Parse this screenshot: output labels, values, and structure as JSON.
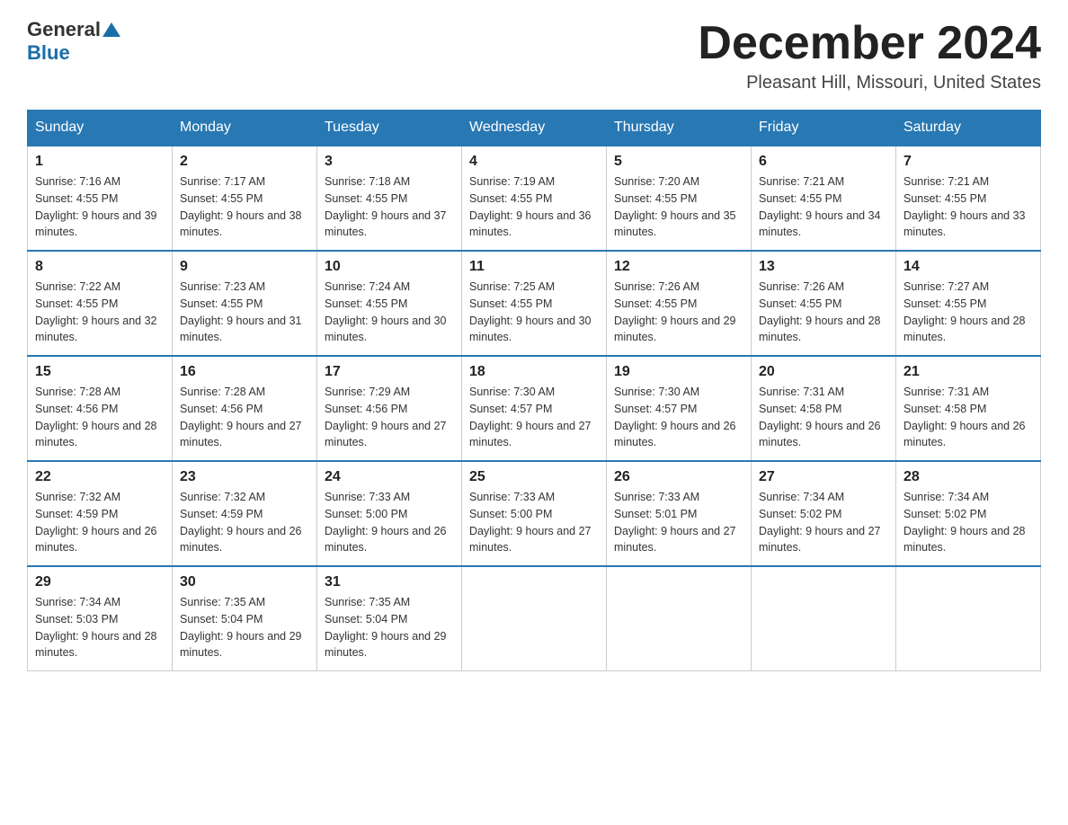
{
  "logo": {
    "general": "General",
    "blue": "Blue"
  },
  "title": "December 2024",
  "location": "Pleasant Hill, Missouri, United States",
  "weekdays": [
    "Sunday",
    "Monday",
    "Tuesday",
    "Wednesday",
    "Thursday",
    "Friday",
    "Saturday"
  ],
  "weeks": [
    [
      {
        "num": "1",
        "sunrise": "7:16 AM",
        "sunset": "4:55 PM",
        "daylight": "9 hours and 39 minutes."
      },
      {
        "num": "2",
        "sunrise": "7:17 AM",
        "sunset": "4:55 PM",
        "daylight": "9 hours and 38 minutes."
      },
      {
        "num": "3",
        "sunrise": "7:18 AM",
        "sunset": "4:55 PM",
        "daylight": "9 hours and 37 minutes."
      },
      {
        "num": "4",
        "sunrise": "7:19 AM",
        "sunset": "4:55 PM",
        "daylight": "9 hours and 36 minutes."
      },
      {
        "num": "5",
        "sunrise": "7:20 AM",
        "sunset": "4:55 PM",
        "daylight": "9 hours and 35 minutes."
      },
      {
        "num": "6",
        "sunrise": "7:21 AM",
        "sunset": "4:55 PM",
        "daylight": "9 hours and 34 minutes."
      },
      {
        "num": "7",
        "sunrise": "7:21 AM",
        "sunset": "4:55 PM",
        "daylight": "9 hours and 33 minutes."
      }
    ],
    [
      {
        "num": "8",
        "sunrise": "7:22 AM",
        "sunset": "4:55 PM",
        "daylight": "9 hours and 32 minutes."
      },
      {
        "num": "9",
        "sunrise": "7:23 AM",
        "sunset": "4:55 PM",
        "daylight": "9 hours and 31 minutes."
      },
      {
        "num": "10",
        "sunrise": "7:24 AM",
        "sunset": "4:55 PM",
        "daylight": "9 hours and 30 minutes."
      },
      {
        "num": "11",
        "sunrise": "7:25 AM",
        "sunset": "4:55 PM",
        "daylight": "9 hours and 30 minutes."
      },
      {
        "num": "12",
        "sunrise": "7:26 AM",
        "sunset": "4:55 PM",
        "daylight": "9 hours and 29 minutes."
      },
      {
        "num": "13",
        "sunrise": "7:26 AM",
        "sunset": "4:55 PM",
        "daylight": "9 hours and 28 minutes."
      },
      {
        "num": "14",
        "sunrise": "7:27 AM",
        "sunset": "4:55 PM",
        "daylight": "9 hours and 28 minutes."
      }
    ],
    [
      {
        "num": "15",
        "sunrise": "7:28 AM",
        "sunset": "4:56 PM",
        "daylight": "9 hours and 28 minutes."
      },
      {
        "num": "16",
        "sunrise": "7:28 AM",
        "sunset": "4:56 PM",
        "daylight": "9 hours and 27 minutes."
      },
      {
        "num": "17",
        "sunrise": "7:29 AM",
        "sunset": "4:56 PM",
        "daylight": "9 hours and 27 minutes."
      },
      {
        "num": "18",
        "sunrise": "7:30 AM",
        "sunset": "4:57 PM",
        "daylight": "9 hours and 27 minutes."
      },
      {
        "num": "19",
        "sunrise": "7:30 AM",
        "sunset": "4:57 PM",
        "daylight": "9 hours and 26 minutes."
      },
      {
        "num": "20",
        "sunrise": "7:31 AM",
        "sunset": "4:58 PM",
        "daylight": "9 hours and 26 minutes."
      },
      {
        "num": "21",
        "sunrise": "7:31 AM",
        "sunset": "4:58 PM",
        "daylight": "9 hours and 26 minutes."
      }
    ],
    [
      {
        "num": "22",
        "sunrise": "7:32 AM",
        "sunset": "4:59 PM",
        "daylight": "9 hours and 26 minutes."
      },
      {
        "num": "23",
        "sunrise": "7:32 AM",
        "sunset": "4:59 PM",
        "daylight": "9 hours and 26 minutes."
      },
      {
        "num": "24",
        "sunrise": "7:33 AM",
        "sunset": "5:00 PM",
        "daylight": "9 hours and 26 minutes."
      },
      {
        "num": "25",
        "sunrise": "7:33 AM",
        "sunset": "5:00 PM",
        "daylight": "9 hours and 27 minutes."
      },
      {
        "num": "26",
        "sunrise": "7:33 AM",
        "sunset": "5:01 PM",
        "daylight": "9 hours and 27 minutes."
      },
      {
        "num": "27",
        "sunrise": "7:34 AM",
        "sunset": "5:02 PM",
        "daylight": "9 hours and 27 minutes."
      },
      {
        "num": "28",
        "sunrise": "7:34 AM",
        "sunset": "5:02 PM",
        "daylight": "9 hours and 28 minutes."
      }
    ],
    [
      {
        "num": "29",
        "sunrise": "7:34 AM",
        "sunset": "5:03 PM",
        "daylight": "9 hours and 28 minutes."
      },
      {
        "num": "30",
        "sunrise": "7:35 AM",
        "sunset": "5:04 PM",
        "daylight": "9 hours and 29 minutes."
      },
      {
        "num": "31",
        "sunrise": "7:35 AM",
        "sunset": "5:04 PM",
        "daylight": "9 hours and 29 minutes."
      },
      null,
      null,
      null,
      null
    ]
  ]
}
